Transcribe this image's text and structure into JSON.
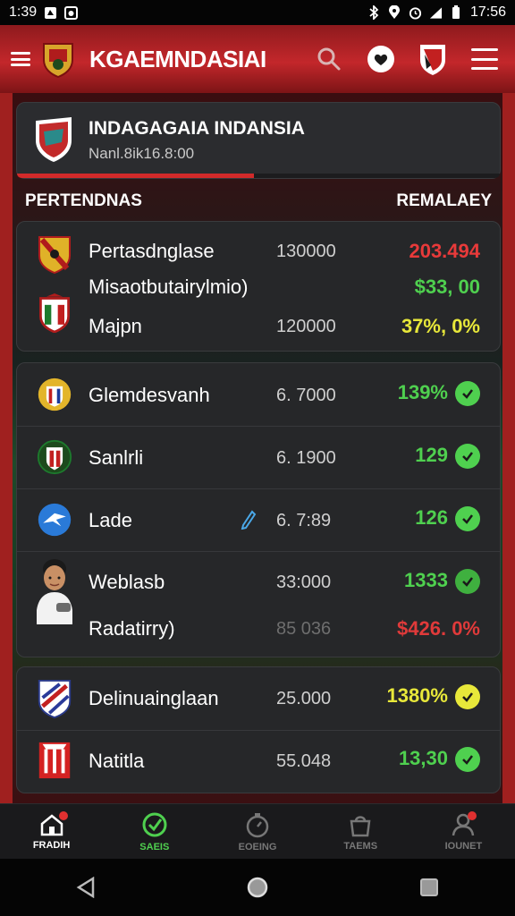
{
  "status_bar": {
    "time_left": "1:39",
    "time_right": "17:56"
  },
  "app_bar": {
    "title": "KGAEMNDASIAI"
  },
  "header_card": {
    "title": "INDAGAGAIA INDANSIA",
    "subtitle": "Nanl.8ik16.8:00",
    "progress": 0.49
  },
  "section": {
    "left_label": "PERTENDNAS",
    "right_label": "REMALAEY"
  },
  "group1": [
    {
      "name": "Pertasdnglase",
      "number": "130000",
      "value": "203.494",
      "value_color": "#e83a3a"
    },
    {
      "name": "Misaotbutairylmio)",
      "number": "",
      "value": "$33, 00",
      "value_color": "#4fd04f"
    },
    {
      "name": "Majpn",
      "number": "120000",
      "value": "37%, 0%",
      "value_color": "#e8e83a"
    }
  ],
  "group2": [
    {
      "name": "Glemdesvanh",
      "number": "6. 7000",
      "value": "139%",
      "value_color": "#4fd04f",
      "status": "check"
    },
    {
      "name": "Sanlrli",
      "number": "6. 1900",
      "value": "129",
      "value_color": "#4fd04f",
      "status": "check"
    },
    {
      "name": "Lade",
      "number": "6. 7:89",
      "value": "126",
      "value_color": "#4fd04f",
      "status": "check"
    },
    {
      "name": "Weblasb",
      "number": "33:000",
      "value": "1333",
      "value_color": "#4fd04f",
      "status": "check"
    },
    {
      "name": "Radatirry)",
      "number": "85 036",
      "value": "$426. 0%",
      "value_color": "#e03a3a",
      "status": ""
    }
  ],
  "group3": [
    {
      "name": "Delinuainglaan",
      "number": "25.000",
      "value": "1380%",
      "value_color": "#e8e83a",
      "status": "check-yellow"
    },
    {
      "name": "Natitla",
      "number": "55.048",
      "value": "13,30",
      "value_color": "#4fd04f",
      "status": "check"
    }
  ],
  "bottom_nav": [
    {
      "label": "FRADIH"
    },
    {
      "label": "SAEIS"
    },
    {
      "label": "EOEING"
    },
    {
      "label": "TAEMS"
    },
    {
      "label": "IOUNET"
    }
  ],
  "colors": {
    "brand_red": "#c3272b",
    "accent_green": "#4fd04f"
  }
}
